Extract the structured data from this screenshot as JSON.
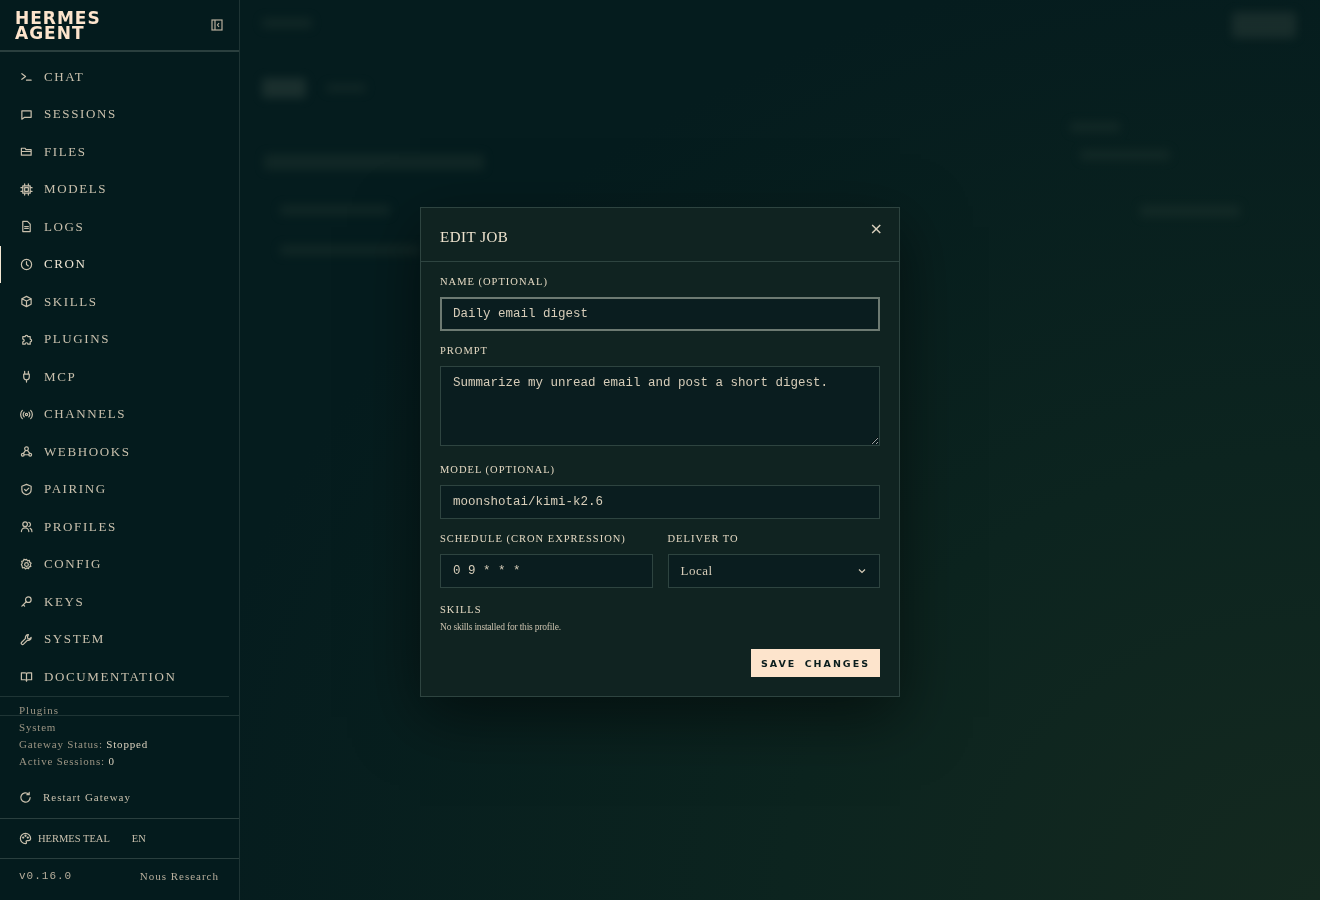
{
  "sidebar": {
    "logo": [
      "HERMES",
      "AGENT"
    ],
    "nav": [
      {
        "label": "CHAT",
        "selected": false
      },
      {
        "label": "SESSIONS",
        "selected": false
      },
      {
        "label": "FILES",
        "selected": false
      },
      {
        "label": "MODELS",
        "selected": false
      },
      {
        "label": "LOGS",
        "selected": false
      },
      {
        "label": "CRON",
        "selected": true
      },
      {
        "label": "SKILLS",
        "selected": false
      },
      {
        "label": "PLUGINS",
        "selected": false
      },
      {
        "label": "MCP",
        "selected": false
      },
      {
        "label": "CHANNELS",
        "selected": false
      },
      {
        "label": "WEBHOOKS",
        "selected": false
      },
      {
        "label": "PAIRING",
        "selected": false
      },
      {
        "label": "PROFILES",
        "selected": false
      },
      {
        "label": "CONFIG",
        "selected": false
      },
      {
        "label": "KEYS",
        "selected": false
      },
      {
        "label": "SYSTEM",
        "selected": false
      },
      {
        "label": "DOCUMENTATION",
        "selected": false
      }
    ],
    "section_heading": "Plugins",
    "system": {
      "heading": "System",
      "lines": [
        "Gateway Status: **Stopped**",
        "Active Sessions: **0**"
      ],
      "restart_button": "Restart Gateway"
    },
    "theme": "HERMES TEAL",
    "language": "EN",
    "version": "v0.16.0",
    "credit": "Nous Research"
  },
  "dialog": {
    "title": "EDIT JOB",
    "close": "×",
    "fields": [
      {
        "kind": "input",
        "label": "NAME (OPTIONAL)",
        "value": "Daily email digest",
        "focused": true
      },
      {
        "kind": "textarea",
        "label": "PROMPT",
        "value": "Summarize my unread email and post a short digest.",
        "focused": false
      },
      {
        "kind": "input",
        "label": "MODEL (OPTIONAL)",
        "value": "moonshotai/kimi-k2.6",
        "focused": false
      }
    ],
    "row": [
      {
        "kind": "input",
        "label": "SCHEDULE (CRON EXPRESSION)",
        "value": "0 9 * * *",
        "focused": false
      },
      {
        "kind": "select",
        "label": "DELIVER TO",
        "value": "Local",
        "focused": false
      }
    ],
    "skills": {
      "label": "SKILLS",
      "note": "No skills installed for this profile."
    },
    "save_button": "SAVE CHANGES"
  }
}
